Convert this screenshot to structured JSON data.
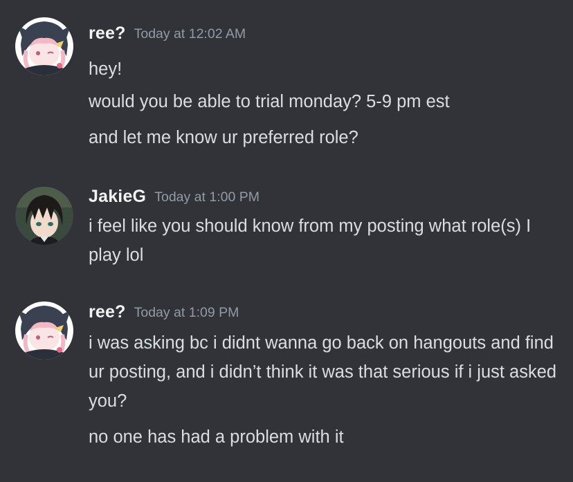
{
  "messages": [
    {
      "username": "ree?",
      "timestamp": "Today at 12:02 AM",
      "avatar_icon": "anime-girl-avatar-icon",
      "lines": [
        "hey!",
        "would you be able to trial monday? 5-9 pm est",
        "and let me know ur preferred role?"
      ]
    },
    {
      "username": "JakieG",
      "timestamp": "Today at 1:00 PM",
      "avatar_icon": "anime-boy-avatar-icon",
      "lines": [
        "i feel like you should know from my posting what role(s) I play lol"
      ]
    },
    {
      "username": "ree?",
      "timestamp": "Today at 1:09 PM",
      "avatar_icon": "anime-girl-avatar-icon",
      "lines": [
        "i was asking bc i didnt wanna go back on hangouts and find ur posting, and i didn’t think it was that serious if i just asked you?",
        "no one has had a problem with it"
      ]
    }
  ],
  "colors": {
    "background": "#313338",
    "username": "#f2f3f5",
    "timestamp": "#949ba4",
    "message_text": "#dbdee1"
  }
}
